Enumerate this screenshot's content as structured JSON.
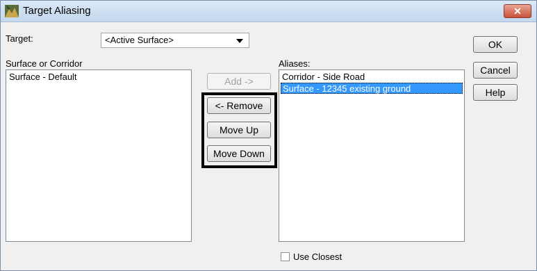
{
  "window": {
    "title": "Target Aliasing",
    "close_glyph": "✕"
  },
  "target": {
    "label": "Target:",
    "selected": "<Active Surface>"
  },
  "source_list": {
    "label": "Surface or Corridor",
    "items": [
      "Surface - Default"
    ]
  },
  "aliases_list": {
    "label": "Aliases:",
    "items": [
      "Corridor - Side Road",
      "Surface - 12345 existing ground"
    ],
    "selected_index": 1
  },
  "buttons": {
    "add": "Add ->",
    "remove": "<- Remove",
    "move_up": "Move Up",
    "move_down": "Move Down",
    "ok": "OK",
    "cancel": "Cancel",
    "help": "Help"
  },
  "use_closest": {
    "label": "Use Closest",
    "checked": false
  },
  "colors": {
    "selection": "#3399ff",
    "close_button": "#c9503a",
    "highlight_border": "#000000"
  }
}
